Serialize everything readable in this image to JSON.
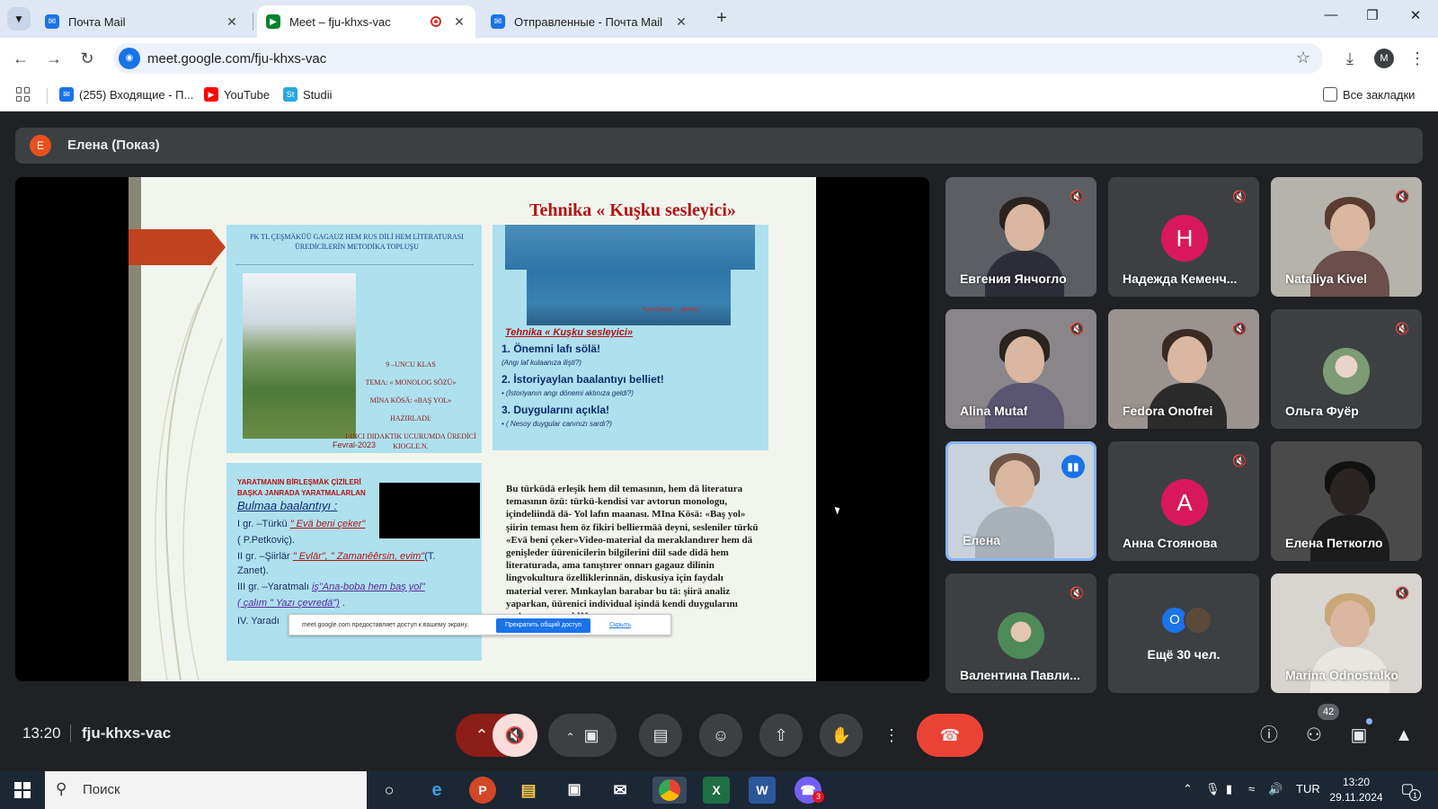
{
  "browser": {
    "tabs": [
      {
        "title": "Почта Mail",
        "favicon": "mail-icon",
        "active": false
      },
      {
        "title": "Meet – fju-khxs-vac",
        "favicon": "meet-icon",
        "active": true,
        "recording": true
      },
      {
        "title": "Отправленные - Почта Mail",
        "favicon": "mail-icon",
        "active": false
      }
    ],
    "url": "meet.google.com/fju-khxs-vac",
    "profile_initial": "M",
    "bookmarks": [
      {
        "label": "(255) Входящие - П...",
        "icon": "mail-icon",
        "color": "#1a73e8"
      },
      {
        "label": "YouTube",
        "icon": "youtube-icon",
        "color": "#ff0000"
      },
      {
        "label": "Studii",
        "icon": "studii-icon",
        "color": "#29a8e0"
      }
    ],
    "all_bookmarks_label": "Все закладки"
  },
  "meet": {
    "presenter": {
      "initial": "E",
      "label": "Елена (Показ)",
      "color": "#e8501f"
    },
    "slide": {
      "title": "Tehnika « Kuşku sesleyici»",
      "panel1": {
        "header": "PK TL ÇEŞMÄKÜÜ GAGAUZ HEM RUS DİLİ HEM LİTERATURASI ÜREDİCİLERİN METODİKA TOPLUŞU",
        "lines": [
          "9 –UNCU KLAS",
          "TEMA: « MONOLOG SÖZÜ»",
          "MİNA KÖSÄ: «BAŞ YOL»",
          "HAZIRLADI:",
          "I-INCI DIDAKTIK UCURUMDA ÜREDİCİ KIOGLE.N."
        ],
        "date": "Fevral-2023"
      },
      "panel2": {
        "caption": "Kara Dengiz ... görüntü",
        "heading": "Tehnika « Kuşku sesleyici»",
        "items": [
          {
            "big": "1. Önemni lafı sölä!",
            "small": "(Angı laf kulaanıza ilişti?)"
          },
          {
            "big": "2. İstoriyaylan baalantıyı belliet!",
            "small": "• (İstoriyanın angı dönemi aklınıza geldi?)"
          },
          {
            "big": "3. Duygularını açıkla!",
            "small": "• ( Nesoy duygular canınızı sardı?)"
          }
        ]
      },
      "panel3": {
        "heading": "YARATMANIN BİRLEŞMÄK ÇİZİLERİ BAŞKA JANRADA YARATMALARLAN",
        "subheading": "Bulmaa baalantıyı :",
        "items": [
          {
            "pre": "I gr. –Türkü ",
            "em": "\" Evä beni çeker\"",
            "post": ""
          },
          {
            "pre": "( P.Petkoviç).",
            "em": "",
            "post": ""
          },
          {
            "pre": "II gr. –Şiirlär ",
            "em": "\" Evlär\", \" Zamanêêrsin, evim\"",
            "post": "(T."
          },
          {
            "pre": "   Zanet).",
            "em": "",
            "post": ""
          },
          {
            "pre": "III gr. –Yaratmalı ",
            "em": "iş\"Ana-boba hem baş yol\"",
            "post": ""
          },
          {
            "pre": "",
            "em": "( çalım \" Yazı çevredä\")",
            "post": " ."
          },
          {
            "pre": "IV. Yaradı",
            "em": "",
            "post": ""
          }
        ]
      },
      "panel4_text": "Bu türküdä erleşik hem dil temasının, hem dä literatura temasının özü: türkü-kendisi var avtorun monologu, içindeliindä dä- Yol lafın maanası. MIna Kösä: «Baş yol» şiirin teması hem öz fikiri belliетmää deyni, sesleniler türkü «Evä beni çeker»Video-material da meraklandırer hem dä genişleder üürenicilerin bilgilerini diil sade didä hem literaturada, ama tanıştırer onnarı gagauz dilinin lingvokultura özelliklerinnän, diskusiya için faydalı material verer. Mınkaylan barabar bu tä: şiirä analiz yaparkan, üürenici individual işindä kendi duygularını resim aşırısı açıklêêr.",
      "share_banner": {
        "message": "meet.google.com предоставляет доступ к вашему экрану.",
        "stop_label": "Прекратить общий доступ",
        "hide_label": "Скрыть"
      }
    },
    "participants": [
      {
        "name": "Евгения Янчогло",
        "type": "video",
        "muted": true,
        "bg": "#6b6659"
      },
      {
        "name": "Надежда Кеменч...",
        "type": "letter",
        "letter": "Н",
        "color": "#d8185a",
        "muted": true
      },
      {
        "name": "Nataliya Kivel",
        "type": "video",
        "muted": true,
        "bg": "#a7a7a1"
      },
      {
        "name": "Alina Mutaf",
        "type": "video",
        "muted": true,
        "bg": "#7e7b7c"
      },
      {
        "name": "Fedora Onofrei",
        "type": "video",
        "muted": true,
        "bg": "#8e8887"
      },
      {
        "name": "Ольга Фуёр",
        "type": "photo",
        "muted": true,
        "color": "#7d9b74"
      },
      {
        "name": "Елена",
        "type": "video",
        "muted": false,
        "speaking": true,
        "bg": "#c9d2da"
      },
      {
        "name": "Анна Стоянова",
        "type": "letter",
        "letter": "А",
        "color": "#d8185a",
        "muted": true
      },
      {
        "name": "Елена Петкогло",
        "type": "video",
        "muted": false,
        "bg": "#4a4a4a"
      },
      {
        "name": "Валентина Павли...",
        "type": "photo",
        "muted": true,
        "color": "#4e8a58"
      },
      {
        "name": "Ещё 30 чел.",
        "type": "more",
        "letters": [
          "O",
          ""
        ],
        "colors": [
          "#1a73e8",
          "#5a4a3a"
        ]
      },
      {
        "name": "Marina Odnostalko",
        "type": "video",
        "muted": true,
        "bg": "#d8d4cf"
      }
    ],
    "controls": {
      "time": "13:20",
      "meeting_code": "fju-khxs-vac",
      "participant_count": "42"
    }
  },
  "taskbar": {
    "search_placeholder": "Поиск",
    "apps": [
      "cortana-icon",
      "edge-icon",
      "powerpoint-icon",
      "explorer-icon",
      "store-icon",
      "mail-icon",
      "chrome-icon",
      "excel-icon",
      "word-icon",
      "viber-icon"
    ],
    "language": "TUR",
    "time": "13:20",
    "date": "29.11.2024",
    "notification_count": "1",
    "viber_badge": "3"
  }
}
